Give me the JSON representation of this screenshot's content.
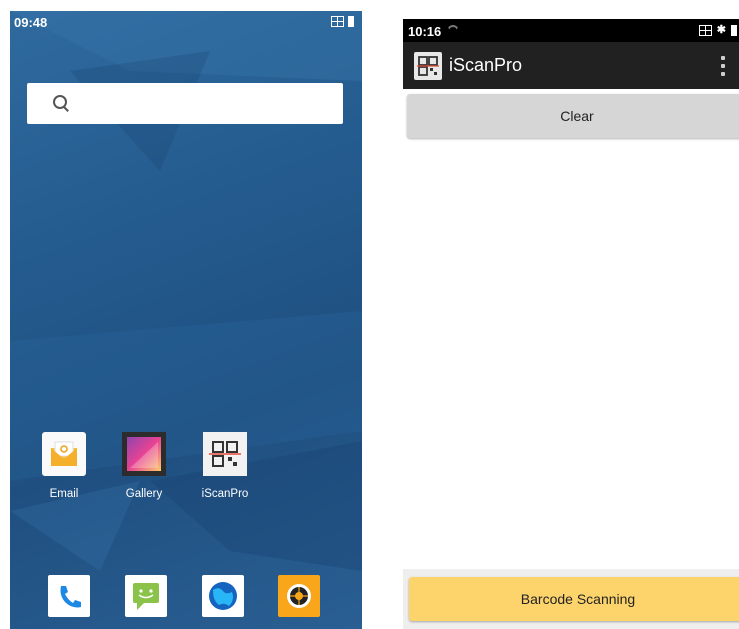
{
  "home": {
    "status_time": "09:48",
    "apps": [
      {
        "label": "Email"
      },
      {
        "label": "Gallery"
      },
      {
        "label": "iScanPro"
      }
    ],
    "dock": [
      "phone-icon",
      "messaging-icon",
      "browser-icon",
      "camera-icon"
    ],
    "colors": {
      "wallpaper": "#245b8e",
      "camera_tile": "#f9a61a",
      "messaging_tile": "#8bc34a"
    }
  },
  "scanner": {
    "status_time": "10:16",
    "app_title": "iScanPro",
    "clear_label": "Clear",
    "scan_label": "Barcode Scanning",
    "colors": {
      "appbar": "#212121",
      "clear_button": "#d6d6d6",
      "scan_button": "#fdd46b"
    }
  }
}
